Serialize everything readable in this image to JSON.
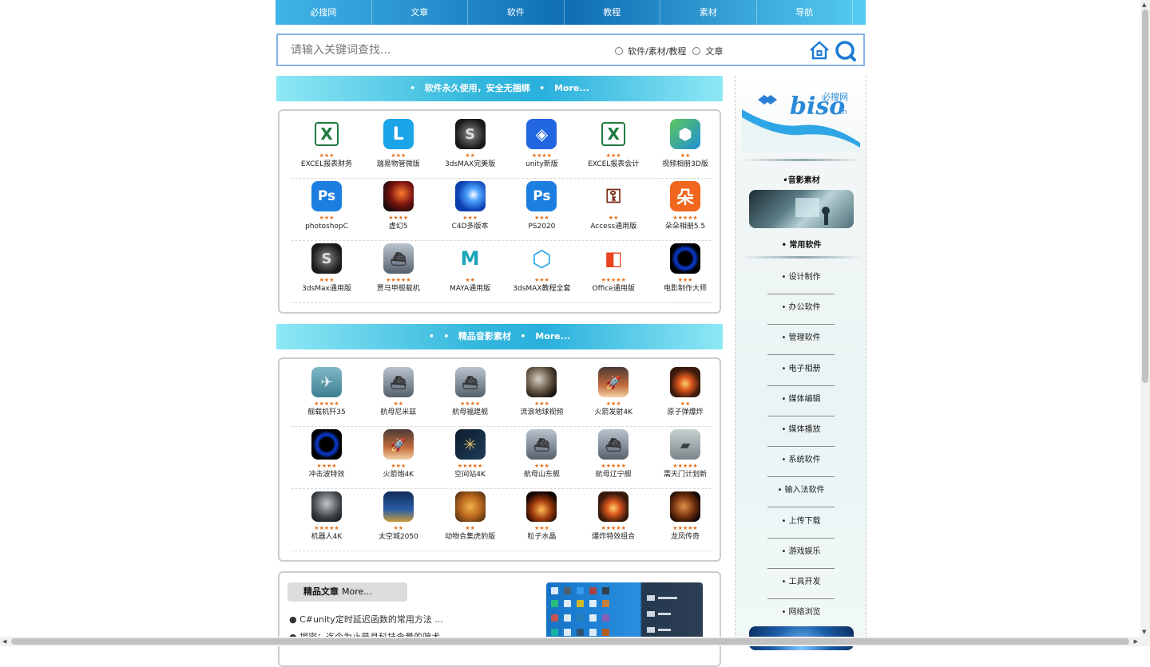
{
  "nav": {
    "items": [
      "必搜网",
      "文章",
      "软件",
      "教程",
      "素材",
      "导航"
    ]
  },
  "search": {
    "placeholder": "请输入关键词查找...",
    "radio1": "软件/素材/教程",
    "radio2": "文章"
  },
  "software": {
    "banner_bullet": "•",
    "banner_title": "软件永久使用，安全无捆绑",
    "banner_more": "More...",
    "items": [
      {
        "name": "EXCEL报表财务",
        "stars": "★★★",
        "icon": "excel-icon"
      },
      {
        "name": "瑞易物管微版",
        "stars": "★★★",
        "icon": "app-l-icon"
      },
      {
        "name": "3dsMAX完美版",
        "stars": "★★",
        "icon": "3dsmax-icon"
      },
      {
        "name": "unity新版",
        "stars": "★★★★",
        "icon": "unity-icon"
      },
      {
        "name": "EXCEL报表会计",
        "stars": "★★★",
        "icon": "excel-icon"
      },
      {
        "name": "视频相册3D版",
        "stars": "★★",
        "icon": "cube-icon"
      },
      {
        "name": "photoshopC",
        "stars": "★★★",
        "icon": "photoshop-icon"
      },
      {
        "name": "虚幻5",
        "stars": "★★★★",
        "icon": "unreal-icon"
      },
      {
        "name": "C4D多版本",
        "stars": "★★★",
        "icon": "c4d-icon"
      },
      {
        "name": "PS2020",
        "stars": "★★★",
        "icon": "photoshop-icon"
      },
      {
        "name": "Access通用版",
        "stars": "★★",
        "icon": "access-icon"
      },
      {
        "name": "朵朵相册5.5",
        "stars": "★★★★★",
        "icon": "duoduo-icon"
      },
      {
        "name": "3dsMax通用版",
        "stars": "★★★",
        "icon": "3dsmax-icon"
      },
      {
        "name": "贾马甲舰载机",
        "stars": "★★★★★",
        "icon": "carrier-icon"
      },
      {
        "name": "MAYA通用版",
        "stars": "★★",
        "icon": "maya-icon"
      },
      {
        "name": "3dsMAX教程全套",
        "stars": "★★★",
        "icon": "crystal-icon"
      },
      {
        "name": "Office通用版",
        "stars": "★★★★★",
        "icon": "office-icon"
      },
      {
        "name": "电影制作大师",
        "stars": "★★★",
        "icon": "ring-icon"
      }
    ]
  },
  "media": {
    "banner_bullet": "•",
    "banner_title": "精品音影素材",
    "banner_more": "More...",
    "items": [
      {
        "name": "舰载机歼35",
        "stars": "★★★★★",
        "icon": "jet-icon"
      },
      {
        "name": "航母尼米兹",
        "stars": "★★",
        "icon": "carrier-icon"
      },
      {
        "name": "航母福建舰",
        "stars": "★★★★",
        "icon": "carrier-icon"
      },
      {
        "name": "流浪地球视频",
        "stars": "★★★",
        "icon": "planet-icon"
      },
      {
        "name": "火箭发射4K",
        "stars": "★★★",
        "icon": "rocket-icon"
      },
      {
        "name": "原子弹爆炸",
        "stars": "★★",
        "icon": "explosion-icon"
      },
      {
        "name": "冲击波特效",
        "stars": "★★★★",
        "icon": "ring-icon"
      },
      {
        "name": "火箭炮4K",
        "stars": "★★★",
        "icon": "rocket-icon"
      },
      {
        "name": "空间站4K",
        "stars": "★★★★★",
        "icon": "station-icon"
      },
      {
        "name": "航母山东舰",
        "stars": "★★★",
        "icon": "carrier-icon"
      },
      {
        "name": "航母辽宁舰",
        "stars": "★★★★★",
        "icon": "carrier-icon"
      },
      {
        "name": "需天门计划新",
        "stars": "★★★★★",
        "icon": "tank-icon"
      },
      {
        "name": "机器人4K",
        "stars": "★★★★★",
        "icon": "robot-icon"
      },
      {
        "name": "太空城2050",
        "stars": "★★",
        "icon": "city-icon"
      },
      {
        "name": "动物合集虎豹版",
        "stars": "★★",
        "icon": "tiger-icon"
      },
      {
        "name": "粒子水晶",
        "stars": "★★★",
        "icon": "particle-icon"
      },
      {
        "name": "爆炸特效组合",
        "stars": "★★★★★",
        "icon": "explosion-icon"
      },
      {
        "name": "龙凤传奇",
        "stars": "★★★★★",
        "icon": "dragon-icon"
      }
    ]
  },
  "articles": {
    "head": "精品文章",
    "more": "More...",
    "items": [
      "● C#unity定时延迟函数的常用方法 ...",
      "● 揭密：迄今为止最具科技含量的骗术 ..."
    ]
  },
  "sidebar": {
    "logo_text": "必搜网",
    "logo_brand": "biso",
    "logo_tld": ".cn",
    "media_header": "•音影素材",
    "software_header": "• 常用软件",
    "links": [
      "• 设计制作",
      "• 办公软件",
      "• 管理软件",
      "• 电子相册",
      "• 媒体编辑",
      "• 媒体播放",
      "• 系统软件",
      "• 输入法软件",
      "• 上传下载",
      "• 游戏娱乐",
      "• 工具开发",
      "• 网络浏览"
    ]
  },
  "colors": {
    "accent": "#2aa9e0",
    "star": "#e8731c",
    "nav_dark": "#0f6db4"
  }
}
